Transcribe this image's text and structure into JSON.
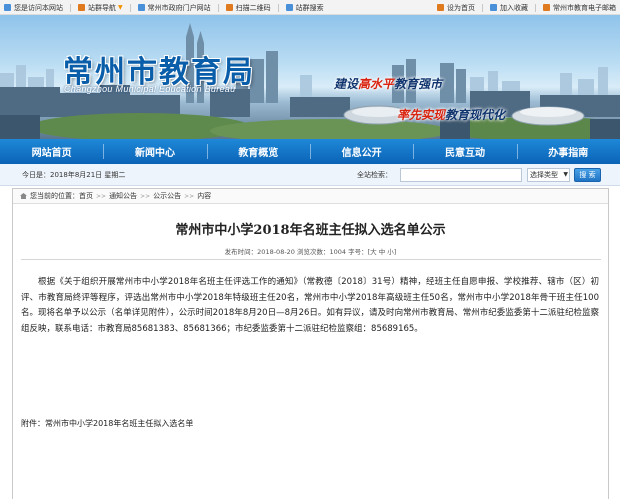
{
  "topbar": {
    "left": [
      {
        "label": "您是访问本网站",
        "icon": "monitor-icon",
        "color": "#4a90d9"
      },
      {
        "label": "站群导航",
        "icon": "grid-icon",
        "color": "#e07a1f",
        "dropdown": true
      },
      {
        "label": "常州市政府门户网站",
        "icon": "home-icon",
        "color": "#4a90d9"
      },
      {
        "label": "扫描二维码",
        "icon": "qrcode-icon",
        "color": "#e07a1f"
      },
      {
        "label": "站群搜索",
        "icon": "search-icon",
        "color": "#4a90d9"
      }
    ],
    "right": [
      {
        "label": "设为首页",
        "icon": "home-icon",
        "color": "#e07a1f"
      },
      {
        "label": "加入收藏",
        "icon": "star-icon",
        "color": "#4a90d9"
      },
      {
        "label": "常州市教育电子邮箱",
        "icon": "mail-icon",
        "color": "#e07a1f"
      }
    ]
  },
  "banner": {
    "title": "常州市教育局",
    "subtitle": "Changzhou Municipal Education Bureau",
    "slogan1_a": "建设",
    "slogan1_b": "高水平",
    "slogan1_c": "教育强市",
    "slogan2_a": "率先实现",
    "slogan2_b": "教育现代化"
  },
  "nav": [
    "网站首页",
    "新闻中心",
    "教育概览",
    "信息公开",
    "民意互动",
    "办事指南"
  ],
  "infobar": {
    "date": "今日是：2018年8月21日 星期二",
    "search_label": "全站检索：",
    "search_value": "",
    "select_value": "选择类型",
    "button": "搜 索"
  },
  "breadcrumb": {
    "prefix": "您当前的位置：",
    "items": [
      "首页",
      "通知公告",
      "公示公告",
      "内容"
    ]
  },
  "article": {
    "title": "常州市中小学2018年名班主任拟入选名单公示",
    "meta": "发布时间：2018-08-20  浏览次数：1004  字号：[大 中 小]",
    "body": "根据《关于组织开展常州市中小学2018年名班主任评选工作的通知》（常教德〔2018〕31号）精神，经班主任自愿申报、学校推荐、辖市（区）初评、市教育局终评等程序，评选出常州市中小学2018年特级班主任20名，常州市中小学2018年高级班主任50名，常州市中小学2018年骨干班主任100名。现将名单予以公示（名单详见附件），公示时间2018年8月20日—8月26日。如有异议，请及时向常州市教育局、常州市纪委监委第十二派驻纪检监察组反映，联系电话：市教育局85681383、85681366；市纪委监委第十二派驻纪检监察组：85689165。",
    "attachment": "附件：常州市中小学2018年名班主任拟入选名单"
  }
}
